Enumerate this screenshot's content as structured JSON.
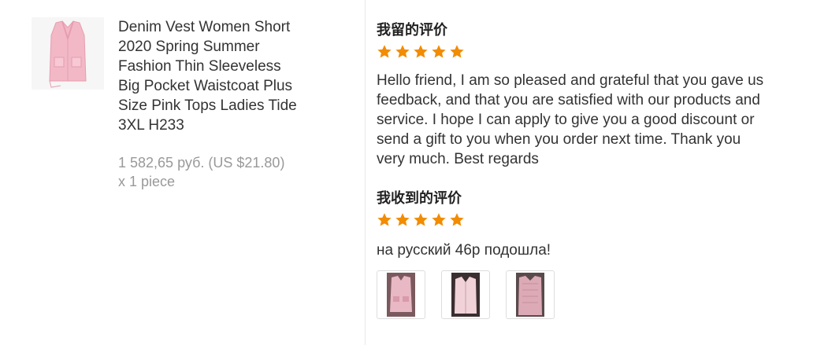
{
  "product": {
    "image_icon": "pink-vest-thumbnail",
    "title_lines": [
      "Denim Vest Women Short",
      "2020 Spring Summer",
      "Fashion Thin Sleeveless",
      "Big Pocket Waistcoat Plus",
      "Size Pink Tops Ladies Tide",
      "3XL H233"
    ],
    "price": "1 582,65 руб. (US $21.80)",
    "quantity": "x 1 piece"
  },
  "my_review": {
    "heading": "我留的评价",
    "stars": 5,
    "text_lines": [
      "Hello friend, I am so pleased and grateful that you gave us",
      "feedback, and that you are satisfied with our products and",
      "service. I hope I can apply to give you a good discount or",
      "send a gift to you when you order next time. Thank you",
      "very much. Best regards"
    ]
  },
  "received_review": {
    "heading": "我收到的评价",
    "stars": 5,
    "text": "на русский 46р подошла!",
    "photos": [
      "review-photo-1",
      "review-photo-2",
      "review-photo-3"
    ]
  },
  "colors": {
    "star": "#f28c00",
    "text": "#333333",
    "muted": "#999999",
    "divider": "#e8e8e8"
  }
}
